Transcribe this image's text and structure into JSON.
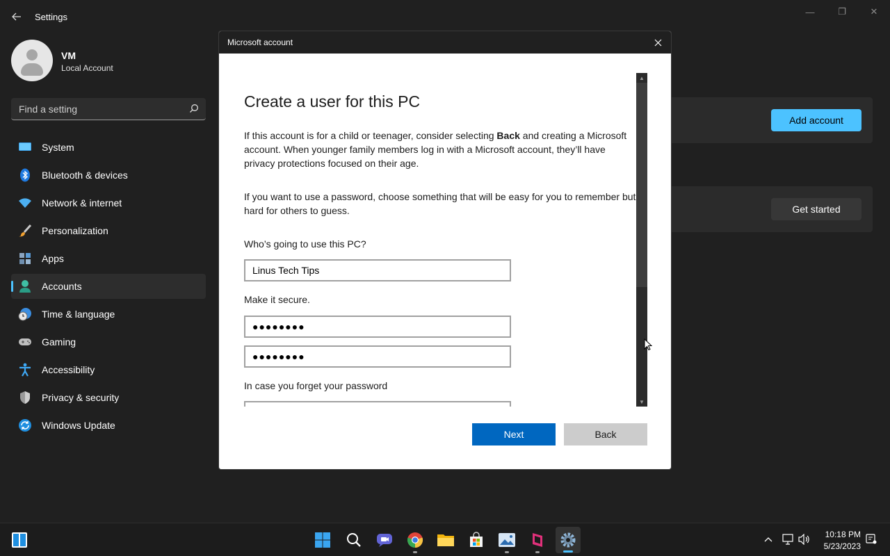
{
  "window": {
    "title": "Settings",
    "back_icon": "back-arrow-icon",
    "controls": {
      "minimize": "—",
      "maximize": "❐",
      "close": "✕"
    }
  },
  "profile": {
    "name": "VM",
    "account_type": "Local Account"
  },
  "search": {
    "placeholder": "Find a setting"
  },
  "sidebar": {
    "items": [
      {
        "label": "System",
        "icon": "system-icon"
      },
      {
        "label": "Bluetooth & devices",
        "icon": "bluetooth-icon"
      },
      {
        "label": "Network & internet",
        "icon": "wifi-icon"
      },
      {
        "label": "Personalization",
        "icon": "brush-icon"
      },
      {
        "label": "Apps",
        "icon": "apps-icon"
      },
      {
        "label": "Accounts",
        "icon": "accounts-icon",
        "active": true
      },
      {
        "label": "Time & language",
        "icon": "globe-clock-icon"
      },
      {
        "label": "Gaming",
        "icon": "gamepad-icon"
      },
      {
        "label": "Accessibility",
        "icon": "accessibility-icon"
      },
      {
        "label": "Privacy & security",
        "icon": "shield-icon"
      },
      {
        "label": "Windows Update",
        "icon": "update-icon"
      }
    ]
  },
  "background": {
    "add_account_label": "Add account",
    "get_started_label": "Get started"
  },
  "dialog": {
    "title": "Microsoft account",
    "heading": "Create a user for this PC",
    "para1_before": "If this account is for a child or teenager, consider selecting ",
    "para1_bold": "Back",
    "para1_after": " and creating a Microsoft account. When younger family members log in with a Microsoft account, they’ll have privacy protections focused on their age.",
    "para2": "If you want to use a password, choose something that will be easy for you to remember but hard for others to guess.",
    "who_label": "Who’s going to use this PC?",
    "name_value": "Linus Tech Tips",
    "secure_label": "Make it secure.",
    "password_value": "●●●●●●●●",
    "confirm_value": "●●●●●●●●",
    "forget_label": "In case you forget your password",
    "next_label": "Next",
    "back_label": "Back"
  },
  "taskbar": {
    "apps": [
      "start-icon",
      "search-icon",
      "chat-icon",
      "chrome-icon",
      "file-explorer-icon",
      "store-icon",
      "photos-icon",
      "app-icon",
      "settings-icon"
    ],
    "time": "10:18 PM",
    "date": "5/23/2023"
  },
  "colors": {
    "accent": "#4cc2ff",
    "dialog_primary": "#0067c0",
    "background": "#202020"
  }
}
